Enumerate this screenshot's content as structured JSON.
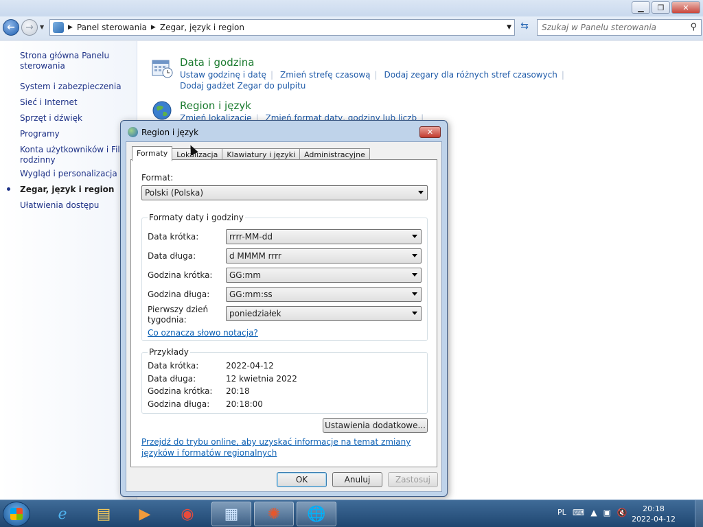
{
  "explorer": {
    "breadcrumb": [
      "Panel sterowania",
      "Zegar, język i region"
    ],
    "search_placeholder": "Szukaj w Panelu sterowania",
    "left_nav": [
      "Strona główna Panelu sterowania",
      "System i zabezpieczenia",
      "Sieć i Internet",
      "Sprzęt i dźwięk",
      "Programy",
      "Konta użytkowników i Filtr rodzinny",
      "Wygląd i personalizacja",
      "Zegar, język i region",
      "Ułatwienia dostępu"
    ],
    "categories": [
      {
        "title": "Data i godzina",
        "links": [
          "Ustaw godzinę i datę",
          "Zmień strefę czasową",
          "Dodaj zegary dla różnych stref czasowych",
          "Dodaj gadżet Zegar do pulpitu"
        ]
      },
      {
        "title": "Region i język",
        "links": [
          "Zmień lokalizację",
          "Zmień format daty, godziny lub liczb"
        ]
      }
    ]
  },
  "dialog": {
    "title": "Region i język",
    "tabs": [
      "Formaty",
      "Lokalizacja",
      "Klawiatury i języki",
      "Administracyjne"
    ],
    "format_label": "Format:",
    "format_value": "Polski (Polska)",
    "date_time_group": {
      "title": "Formaty daty i godziny",
      "rows": [
        {
          "label": "Data krótka:",
          "value": "rrrr-MM-dd"
        },
        {
          "label": "Data długa:",
          "value": "d MMMM rrrr"
        },
        {
          "label": "Godzina krótka:",
          "value": "GG:mm"
        },
        {
          "label": "Godzina długa:",
          "value": "GG:mm:ss"
        },
        {
          "label": "Pierwszy dzień tygodnia:",
          "value": "poniedziałek"
        }
      ],
      "notation_link": "Co oznacza słowo notacja?"
    },
    "examples_group": {
      "title": "Przykłady",
      "rows": [
        {
          "label": "Data krótka:",
          "value": "2022-04-12"
        },
        {
          "label": "Data długa:",
          "value": "12 kwietnia 2022"
        },
        {
          "label": "Godzina krótka:",
          "value": "20:18"
        },
        {
          "label": "Godzina długa:",
          "value": "20:18:00"
        }
      ]
    },
    "additional_settings_button": "Ustawienia dodatkowe...",
    "online_link": "Przejdź do trybu online, aby uzyskać informacje na temat zmiany języków i formatów regionalnych",
    "buttons": {
      "ok": "OK",
      "cancel": "Anuluj",
      "apply": "Zastosuj"
    }
  },
  "taskbar": {
    "language": "PL",
    "time": "20:18",
    "date": "2022-04-12"
  }
}
